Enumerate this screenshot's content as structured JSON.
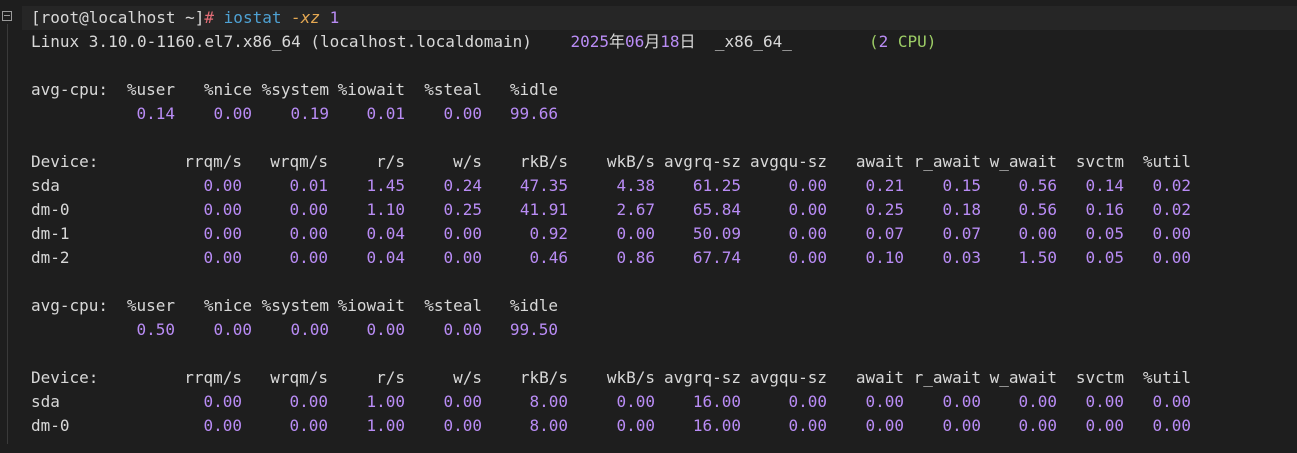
{
  "colors": {
    "background": "#1e1e1e",
    "text": "#d8d8d8",
    "number": "#b98cf5",
    "command": "#4ea1d3",
    "flag": "#e5a852",
    "hash": "#e06c75",
    "cpu": "#9ccc65"
  },
  "icons": {
    "fold": "fold-collapse-icon"
  },
  "prompt": {
    "user_host": "[root@localhost ~]",
    "symbol": "#",
    "command": "iostat",
    "flags": "-xz",
    "interval": "1"
  },
  "sysinfo": {
    "kernel": "Linux 3.10.0-1160.el7.x86_64 (localhost.localdomain)",
    "date_year": "2025",
    "date_y": "年",
    "date_month": "06",
    "date_m": "月",
    "date_day": "18",
    "date_d": "日",
    "arch": "_x86_64_",
    "cpu_open": "(",
    "cpu_count": "2",
    "cpu_label": " CPU)"
  },
  "cpu_header": [
    "avg-cpu:",
    "%user",
    "%nice",
    "%system",
    "%iowait",
    "%steal",
    "%idle"
  ],
  "device_header": [
    "Device:",
    "rrqm/s",
    "wrqm/s",
    "r/s",
    "w/s",
    "rkB/s",
    "wkB/s",
    "avgrq-sz",
    "avgqu-sz",
    "await",
    "r_await",
    "w_await",
    "svctm",
    "%util"
  ],
  "report1": {
    "cpu": [
      "0.14",
      "0.00",
      "0.19",
      "0.01",
      "0.00",
      "99.66"
    ],
    "devices": [
      [
        "sda",
        "0.00",
        "0.01",
        "1.45",
        "0.24",
        "47.35",
        "4.38",
        "61.25",
        "0.00",
        "0.21",
        "0.15",
        "0.56",
        "0.14",
        "0.02"
      ],
      [
        "dm-0",
        "0.00",
        "0.00",
        "1.10",
        "0.25",
        "41.91",
        "2.67",
        "65.84",
        "0.00",
        "0.25",
        "0.18",
        "0.56",
        "0.16",
        "0.02"
      ],
      [
        "dm-1",
        "0.00",
        "0.00",
        "0.04",
        "0.00",
        "0.92",
        "0.00",
        "50.09",
        "0.00",
        "0.07",
        "0.07",
        "0.00",
        "0.05",
        "0.00"
      ],
      [
        "dm-2",
        "0.00",
        "0.00",
        "0.04",
        "0.00",
        "0.46",
        "0.86",
        "67.74",
        "0.00",
        "0.10",
        "0.03",
        "1.50",
        "0.05",
        "0.00"
      ]
    ]
  },
  "report2": {
    "cpu": [
      "0.50",
      "0.00",
      "0.00",
      "0.00",
      "0.00",
      "99.50"
    ],
    "devices": [
      [
        "sda",
        "0.00",
        "0.00",
        "1.00",
        "0.00",
        "8.00",
        "0.00",
        "16.00",
        "0.00",
        "0.00",
        "0.00",
        "0.00",
        "0.00",
        "0.00"
      ],
      [
        "dm-0",
        "0.00",
        "0.00",
        "1.00",
        "0.00",
        "8.00",
        "0.00",
        "16.00",
        "0.00",
        "0.00",
        "0.00",
        "0.00",
        "0.00",
        "0.00"
      ]
    ]
  }
}
